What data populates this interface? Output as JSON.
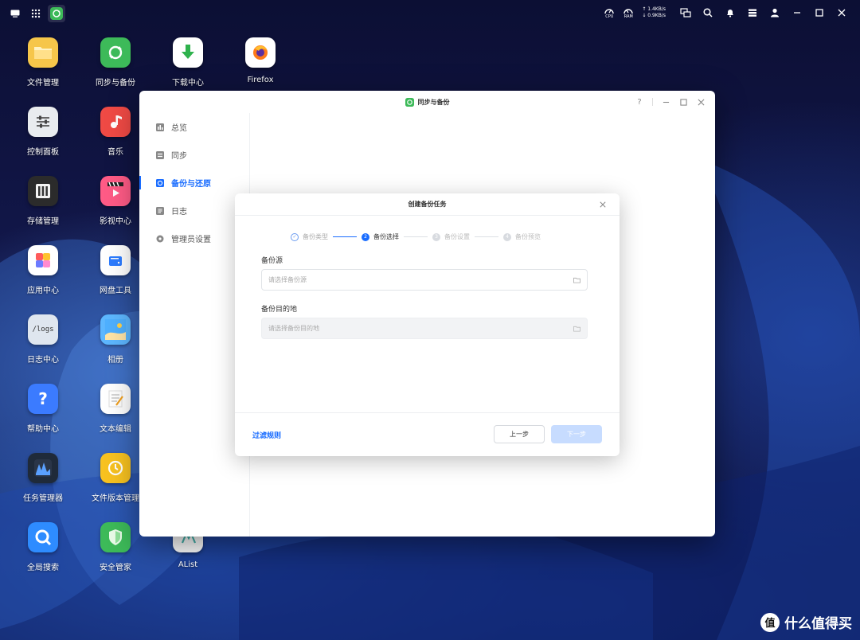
{
  "topbar": {
    "net_up": "↑ 1.4KB/s",
    "net_down": "↓ 0.9KB/s",
    "cpu_label": "CPU",
    "ram_label": "RAM"
  },
  "desktop_icons": [
    {
      "label": "文件管理",
      "icon": "folder-icon",
      "color": "#f6c64a"
    },
    {
      "label": "同步与备份",
      "icon": "sync-icon",
      "color": "#3dba59"
    },
    {
      "label": "下载中心",
      "icon": "download-icon",
      "color": "#ffffff"
    },
    {
      "label": "Firefox",
      "icon": "firefox-icon",
      "color": "#ffffff"
    },
    {
      "label": "控制面板",
      "icon": "control-panel-icon",
      "color": "#e9ecef"
    },
    {
      "label": "音乐",
      "icon": "music-icon",
      "color": "#f04a45"
    },
    {
      "label": "存储管理",
      "icon": "storage-icon",
      "color": "#2b2b2b"
    },
    {
      "label": "影视中心",
      "icon": "video-icon",
      "color": "#ff5b86"
    },
    {
      "label": "应用中心",
      "icon": "app-center-icon",
      "color": "#ffffff"
    },
    {
      "label": "网盘工具",
      "icon": "cloud-drive-icon",
      "color": "#ffffff"
    },
    {
      "label": "日志中心",
      "icon": "logs-icon",
      "color": "#dfe6ef"
    },
    {
      "label": "相册",
      "icon": "photos-icon",
      "color": "#5db7ff"
    },
    {
      "label": "帮助中心",
      "icon": "help-icon",
      "color": "#3b7bff"
    },
    {
      "label": "文本编辑",
      "icon": "text-editor-icon",
      "color": "#ffffff"
    },
    {
      "label": "任务管理器",
      "icon": "task-manager-icon",
      "color": "#1f2a3a"
    },
    {
      "label": "文件版本管理",
      "icon": "file-version-icon",
      "color": "#f8c220"
    },
    {
      "label": "全局搜索",
      "icon": "global-search-icon",
      "color": "#2e8cff"
    },
    {
      "label": "安全管家",
      "icon": "security-icon",
      "color": "#3dba59"
    },
    {
      "label": "AList",
      "icon": "alist-icon",
      "color": "#ffffff"
    }
  ],
  "logs_tile_text": "/logs",
  "window": {
    "title": "同步与备份",
    "help": "?",
    "sidebar": [
      {
        "label": "总览",
        "icon": "overview-icon"
      },
      {
        "label": "同步",
        "icon": "sync-list-icon"
      },
      {
        "label": "备份与还原",
        "icon": "backup-icon",
        "active": true
      },
      {
        "label": "日志",
        "icon": "log-icon"
      },
      {
        "label": "管理员设置",
        "icon": "settings-icon"
      }
    ]
  },
  "modal": {
    "title": "创建备份任务",
    "steps": [
      {
        "label": "备份类型",
        "state": "done",
        "num": "✓"
      },
      {
        "label": "备份选择",
        "state": "active",
        "num": "2"
      },
      {
        "label": "备份设置",
        "state": "todo",
        "num": "3"
      },
      {
        "label": "备份预览",
        "state": "todo",
        "num": "4"
      }
    ],
    "source_label": "备份源",
    "source_placeholder": "请选择备份源",
    "dest_label": "备份目的地",
    "dest_placeholder": "请选择备份目的地",
    "filter_link": "过滤规则",
    "prev_button": "上一步",
    "next_button": "下一步"
  },
  "watermark": {
    "badge": "值",
    "text": "什么值得买"
  }
}
